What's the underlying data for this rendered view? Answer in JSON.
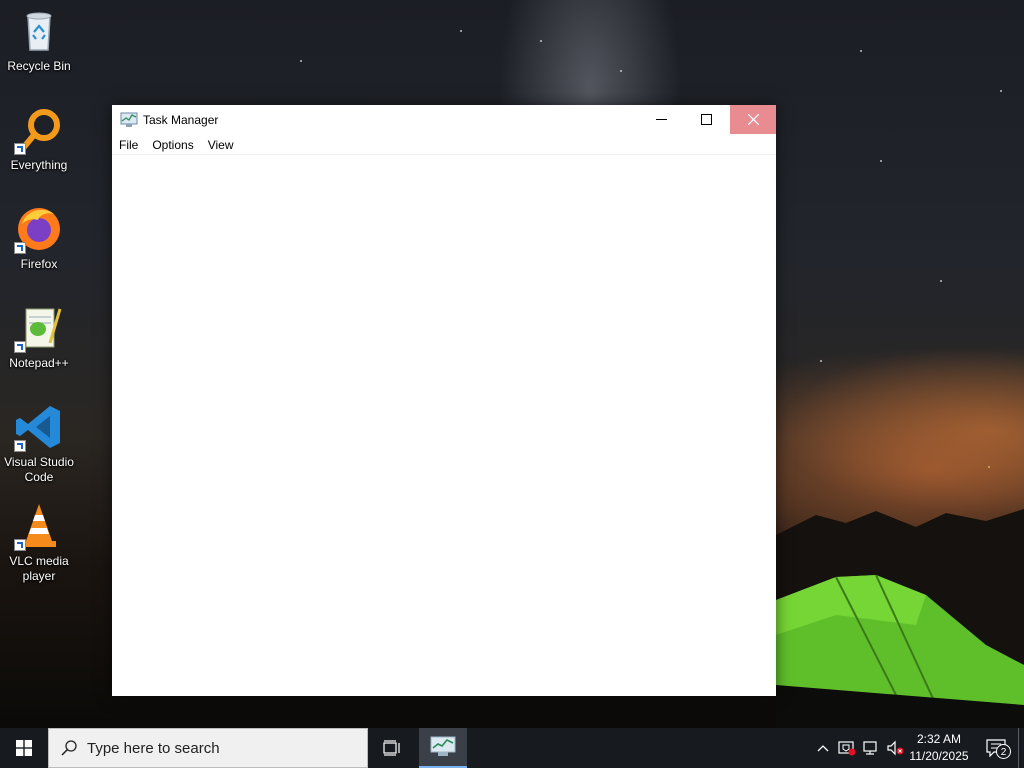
{
  "desktop": {
    "icons": [
      {
        "label": "Recycle Bin",
        "icon": "recycle-bin-icon"
      },
      {
        "label": "Everything",
        "icon": "everything-search-icon"
      },
      {
        "label": "Firefox",
        "icon": "firefox-icon"
      },
      {
        "label": "Notepad++",
        "icon": "notepad-plus-plus-icon"
      },
      {
        "label": "Visual Studio\nCode",
        "icon": "vscode-icon"
      },
      {
        "label": "VLC media\nplayer",
        "icon": "vlc-icon"
      }
    ]
  },
  "window": {
    "title": "Task Manager",
    "menu": [
      "File",
      "Options",
      "View"
    ],
    "close_hover_color": "#e98c92"
  },
  "taskbar": {
    "search_placeholder": "Type here to search",
    "clock_time": "2:32 AM",
    "clock_date": "11/20/2025",
    "notification_count": "2",
    "active_app": "Task Manager",
    "accent_color": "#77b4f0"
  }
}
